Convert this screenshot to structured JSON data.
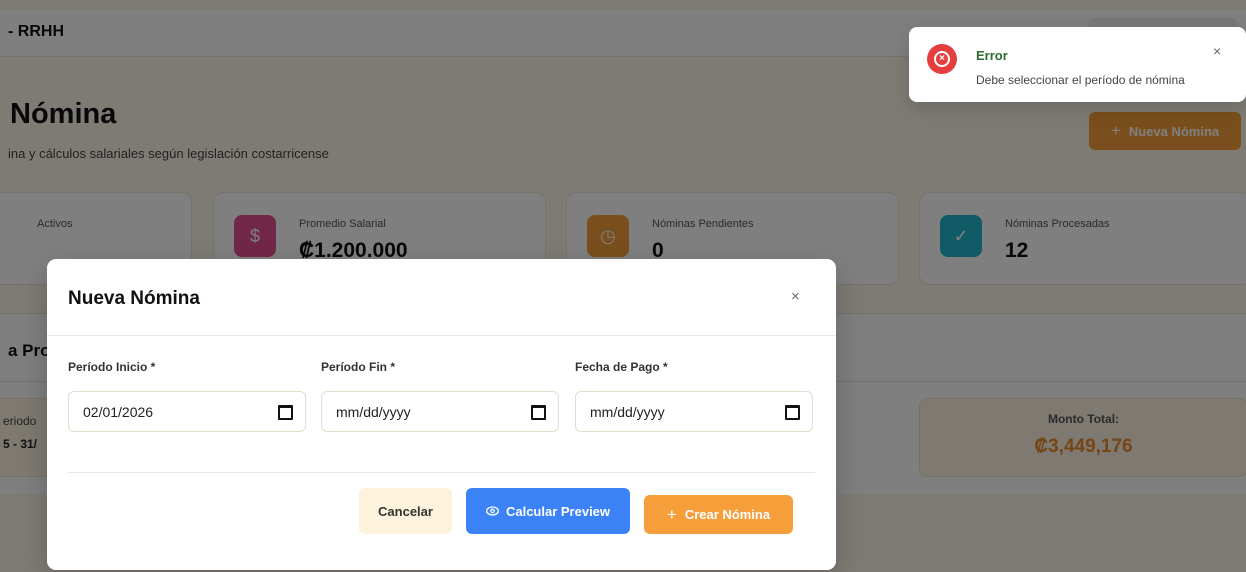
{
  "topbar": {
    "brand": "- RRHH"
  },
  "header": {
    "title": "Nómina",
    "subtitle": "ina y cálculos salariales según legislación costarricense",
    "new_button": {
      "icon": "plus-icon",
      "label": "Nueva Nómina"
    }
  },
  "stats": [
    {
      "label": "Activos",
      "value": ""
    },
    {
      "icon": "dollar-icon",
      "label": "Promedio Salarial",
      "value": "₡1.200.000"
    },
    {
      "icon": "clock-icon",
      "label": "Nóminas Pendientes",
      "value": "0"
    },
    {
      "icon": "check-circle-icon",
      "label": "Nóminas Procesadas",
      "value": "12"
    }
  ],
  "section": {
    "title": "a Pro",
    "period_label": "eriodo",
    "period_value": "5 - 31/",
    "total_label": "Monto Total:",
    "total_value": "₡3,449,176"
  },
  "modal": {
    "title": "Nueva Nómina",
    "close": "×",
    "fields": [
      {
        "label": "Período Inicio *",
        "value": "02/01/2026"
      },
      {
        "label": "Período Fin *",
        "value": "mm/dd/yyyy"
      },
      {
        "label": "Fecha de Pago *",
        "value": "mm/dd/yyyy"
      }
    ],
    "buttons": {
      "cancel": "Cancelar",
      "calc": "Calcular Preview",
      "create": "Crear Nómina"
    }
  },
  "toast": {
    "icon": "error-circle-icon",
    "title": "Error",
    "message": "Debe seleccionar el período de nómina",
    "close": "×"
  },
  "colors": {
    "accent": "#f59e3a",
    "primary": "#3b82f6",
    "error": "#e53e3e",
    "stat_icon_1": "#e34f8f",
    "stat_icon_2": "#f59e3a",
    "stat_icon_3": "#22b7cf"
  }
}
